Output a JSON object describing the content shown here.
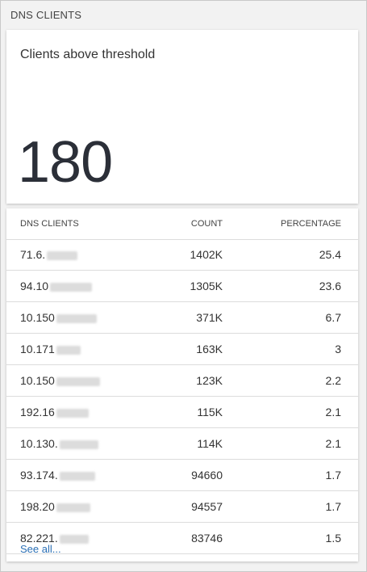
{
  "tile": {
    "title": "DNS CLIENTS"
  },
  "kpi": {
    "label": "Clients above threshold",
    "value": "180"
  },
  "table": {
    "headers": {
      "client": "DNS CLIENTS",
      "count": "COUNT",
      "percentage": "PERCENTAGE"
    },
    "rows": [
      {
        "client": "71.6.",
        "count": "1402K",
        "percentage": "25.4"
      },
      {
        "client": "94.10",
        "count": "1305K",
        "percentage": "23.6"
      },
      {
        "client": "10.150",
        "count": "371K",
        "percentage": "6.7"
      },
      {
        "client": "10.171",
        "count": "163K",
        "percentage": "3"
      },
      {
        "client": "10.150",
        "count": "123K",
        "percentage": "2.2"
      },
      {
        "client": "192.16",
        "count": "115K",
        "percentage": "2.1"
      },
      {
        "client": "10.130.",
        "count": "114K",
        "percentage": "2.1"
      },
      {
        "client": "93.174.",
        "count": "94660",
        "percentage": "1.7"
      },
      {
        "client": "198.20",
        "count": "94557",
        "percentage": "1.7"
      },
      {
        "client": "82.221.",
        "count": "83746",
        "percentage": "1.5"
      }
    ]
  },
  "footer": {
    "see_all": "See all..."
  },
  "colors": {
    "link": "#2a6fb5",
    "value": "#2b2f38",
    "border": "#dcdcdc"
  }
}
